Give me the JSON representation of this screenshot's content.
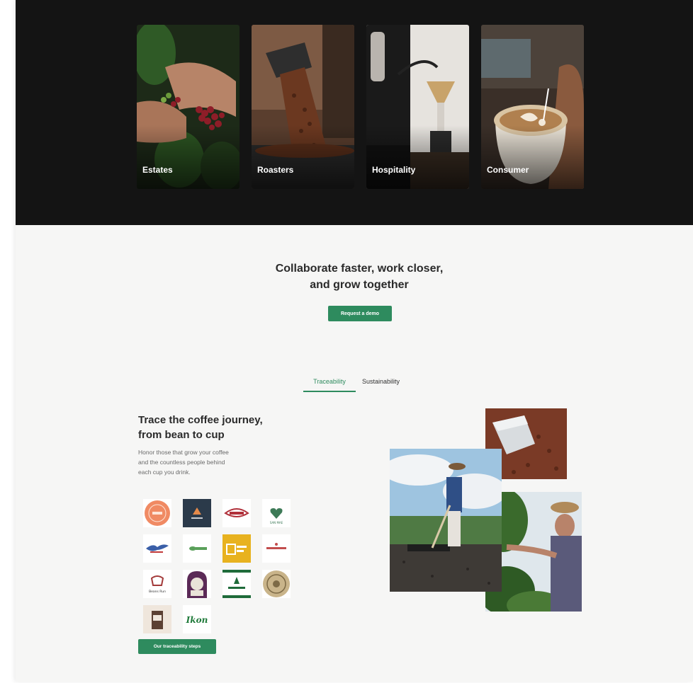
{
  "hero": {
    "cards": [
      {
        "label": "Estates"
      },
      {
        "label": "Roasters"
      },
      {
        "label": "Hospitality"
      },
      {
        "label": "Consumer"
      }
    ]
  },
  "cta": {
    "title": "Collaborate faster, work closer,\nand grow together",
    "button": "Request a demo"
  },
  "tabs": [
    {
      "label": "Traceability",
      "active": true
    },
    {
      "label": "Sustainability",
      "active": false
    }
  ],
  "traceability": {
    "heading": "Trace the coffee journey,\nfrom bean to cup",
    "body": "Honor those that grow your coffee\nand the countless people behind\neach cup you drink.",
    "button": "Our traceability steps",
    "logos": [
      {
        "icon": "orange-circle-logo"
      },
      {
        "icon": "dark-navy-logo"
      },
      {
        "icon": "red-script-logo"
      },
      {
        "icon": "green-heart-logo",
        "text": "SAN MAE"
      },
      {
        "icon": "blue-bird-logo"
      },
      {
        "icon": "green-leaf-logo"
      },
      {
        "icon": "yellow-box-logo"
      },
      {
        "icon": "red-wordmark-logo"
      },
      {
        "icon": "teapot-logo",
        "text": "Beans Run"
      },
      {
        "icon": "purple-portrait-logo"
      },
      {
        "icon": "green-stripe-logo"
      },
      {
        "icon": "beige-seal-logo"
      },
      {
        "icon": "bag-logo"
      },
      {
        "icon": "green-wordmark-logo",
        "text": "Ikon"
      }
    ]
  },
  "colors": {
    "accent": "#2e8b5e",
    "hero_bg": "#141414",
    "page_bg": "#f6f6f5"
  }
}
